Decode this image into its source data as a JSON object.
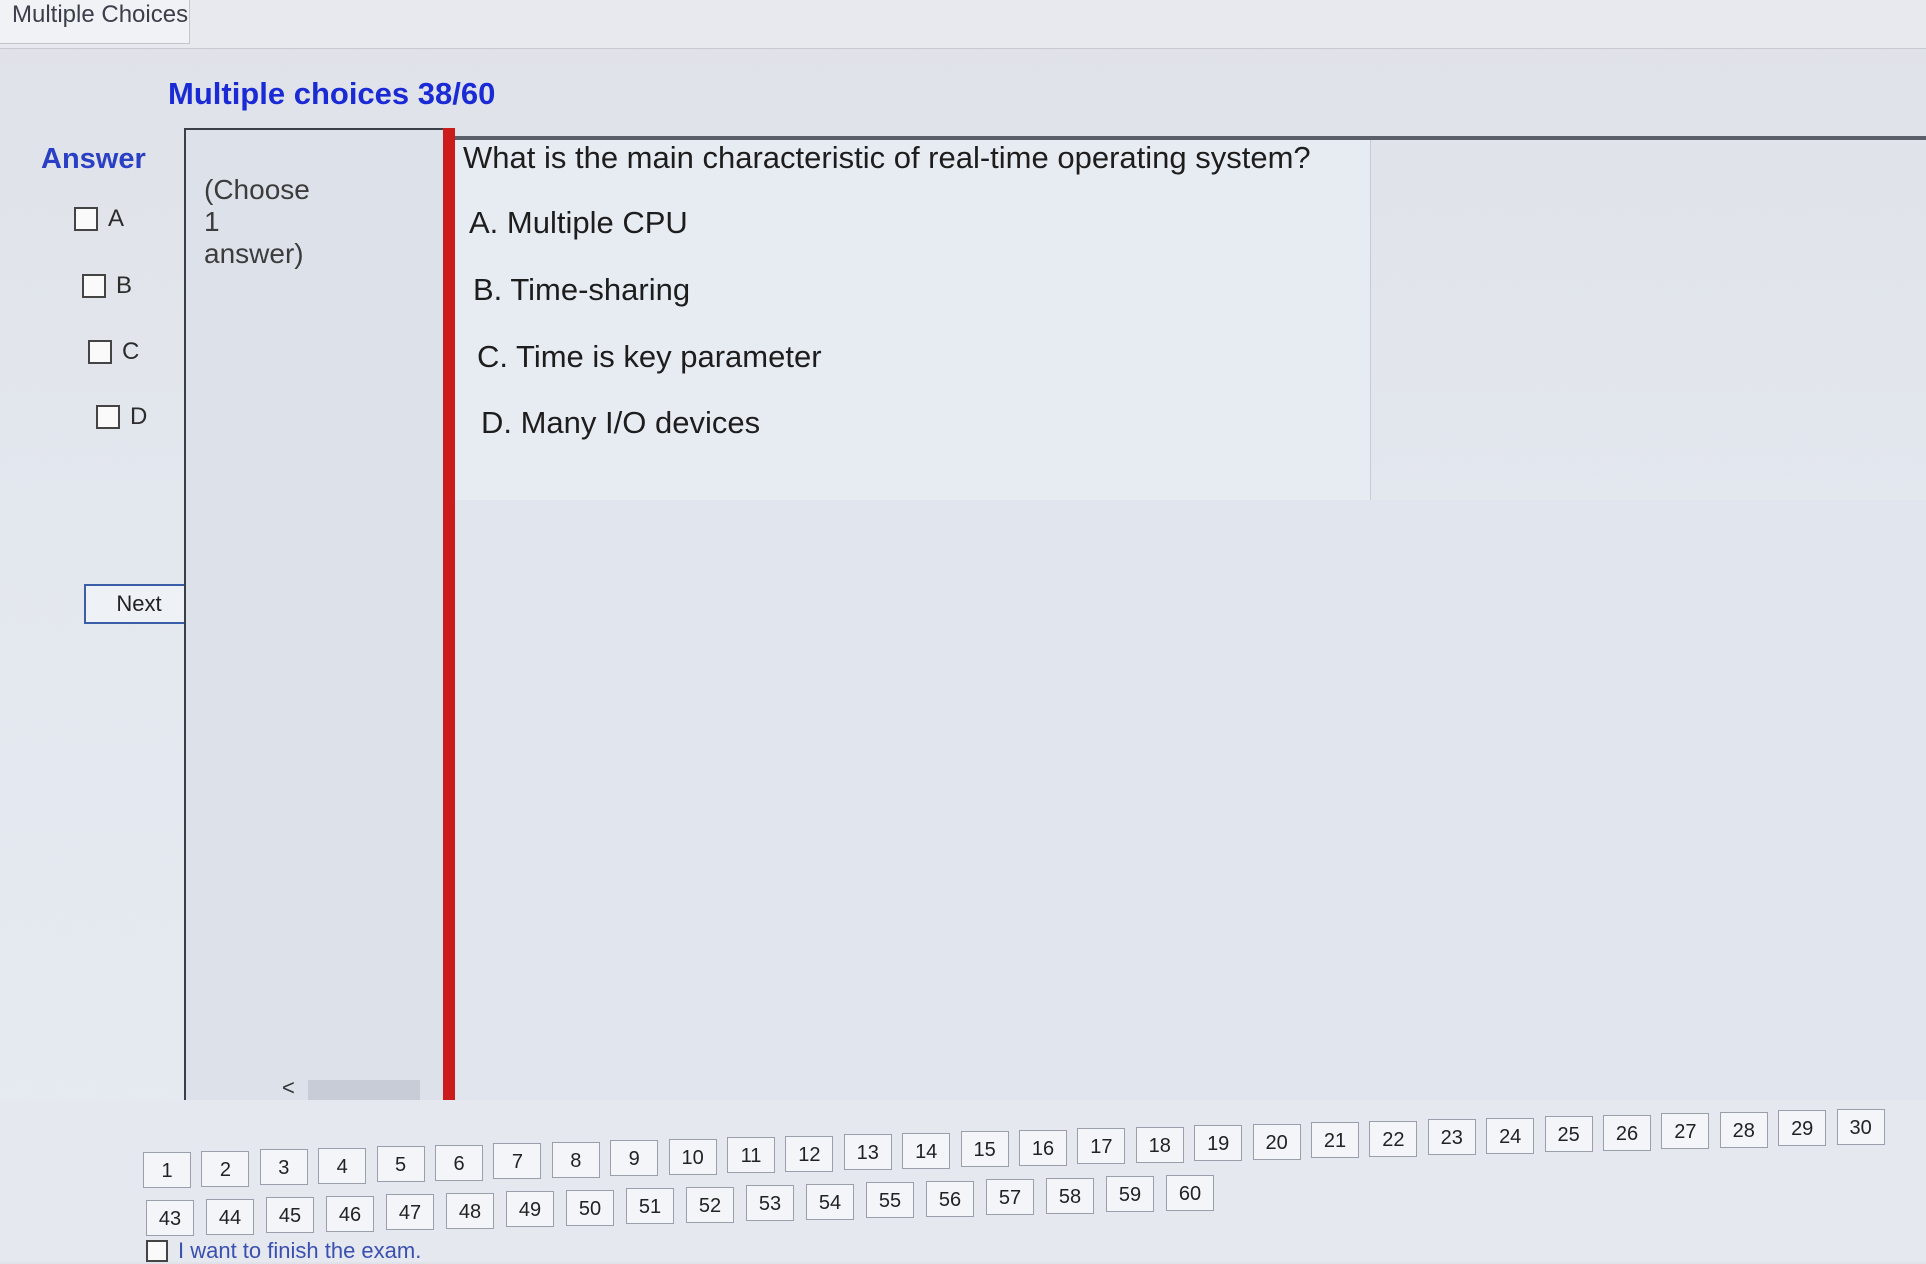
{
  "tab": {
    "label": "Multiple Choices"
  },
  "header": {
    "title": "Multiple choices 38/60"
  },
  "answer": {
    "heading": "Answer",
    "options": [
      "A",
      "B",
      "C",
      "D"
    ],
    "next_label": "Next"
  },
  "instruction": {
    "line1": "(Choose",
    "line2": "1",
    "line3": "answer)"
  },
  "scroll": {
    "left": "<",
    "right": ">"
  },
  "question": {
    "text": "What is the main characteristic of real-time operating system?",
    "options": [
      "A. Multiple CPU",
      "B. Time-sharing",
      "C. Time is key parameter",
      "D. Many I/O devices"
    ]
  },
  "nav": {
    "row1": [
      "1",
      "2",
      "3",
      "4",
      "5",
      "6",
      "7",
      "8",
      "9",
      "10",
      "11",
      "12",
      "13",
      "14",
      "15",
      "16",
      "17",
      "18",
      "19",
      "20",
      "21",
      "22",
      "23",
      "24",
      "25",
      "26",
      "27",
      "28",
      "29",
      "30"
    ],
    "row2": [
      "43",
      "44",
      "45",
      "46",
      "47",
      "48",
      "49",
      "50",
      "51",
      "52",
      "53",
      "54",
      "55",
      "56",
      "57",
      "58",
      "59",
      "60"
    ]
  },
  "finish": {
    "label": "I want to finish the exam."
  },
  "colors": {
    "accent": "#1a2bd6",
    "divider": "#cc1b1b"
  }
}
